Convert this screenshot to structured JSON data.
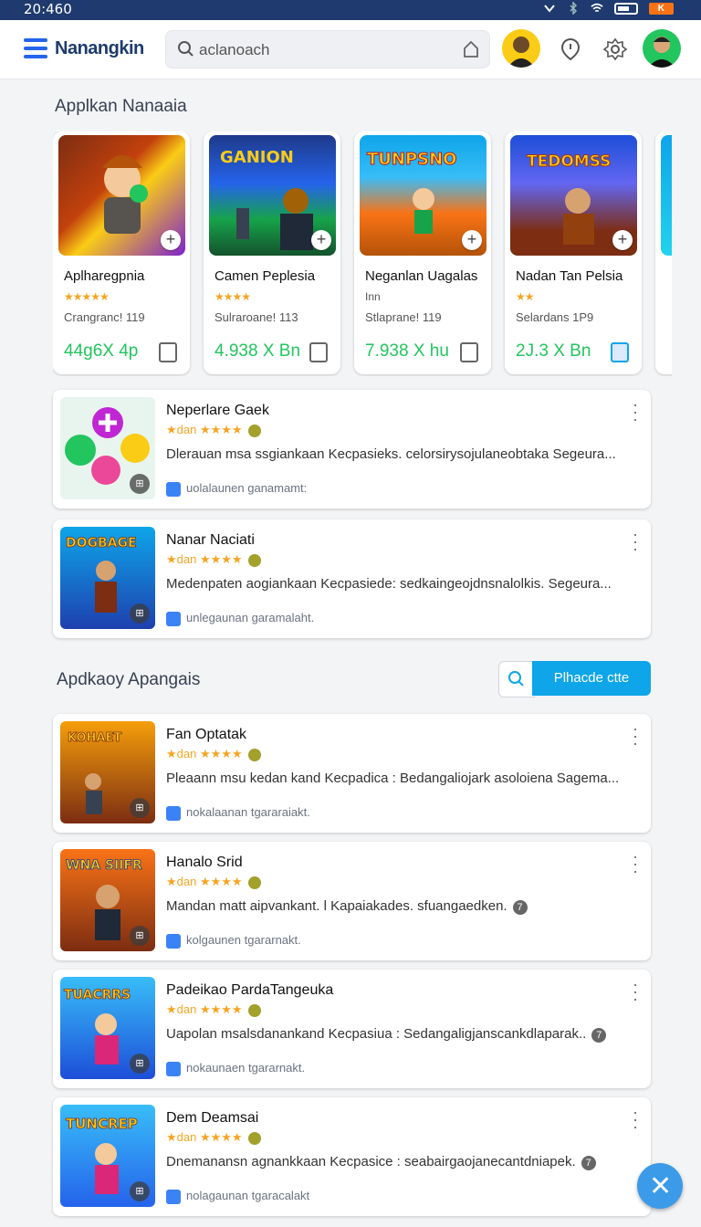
{
  "status": {
    "time": "20:460",
    "badge": "K"
  },
  "appbar": {
    "brand": "Nanangkin",
    "search_placeholder": "aclanoach"
  },
  "sections": {
    "featured_title": "Applkan Nanaaia",
    "list_title": "Apdkaoy Apangais",
    "filter_button": "Plhacde ctte"
  },
  "featured": [
    {
      "name": "Aplharegpnia",
      "stars": "★★★★★",
      "sub": "Crangranc! 119",
      "price": "44g6X 4p"
    },
    {
      "name": "Camen Peplesia",
      "stars": "★★★★",
      "sub": "Sulraroane! 113",
      "price": "4.938 X Bn"
    },
    {
      "name": "Neganlan Uagalas",
      "stars": "Inn",
      "sub": "Stlaprane! 119",
      "price": "7.938 X hu"
    },
    {
      "name": "Nadan Tan Pelsia",
      "stars": "★★",
      "sub": "Selardans 1P9",
      "price": "2J.3 X Bn"
    }
  ],
  "recommended": [
    {
      "title": "Neperlare Gaek",
      "rating": "★dan ★★★★",
      "desc": "Dlerauan msa ssgiankaan Kecpasieks. celorsirysojulaneobtaka Segeura...",
      "tag": "uolalaunen ganamamt:"
    },
    {
      "title": "Nanar Naciati",
      "rating": "★dan ★★★★",
      "desc": "Medenpaten aogiankaan Kecpasiede: sedkaingeojdnsnalolkis. Segeura...",
      "tag": "unlegaunan garamalaht."
    }
  ],
  "list": [
    {
      "title": "Fan Optatak",
      "rating": "★dan ★★★★",
      "desc": "Pleaann msu kedan kand Kecpadica : Bedangaliojark asoloiena Sagema...",
      "tag": "nokalaanan tgararaiakt.",
      "q": ""
    },
    {
      "title": "Hanalo Srid",
      "rating": "★dan ★★★★",
      "desc": "Mandan matt aipvankant. l Kapaiakades. sfuangaedken.",
      "tag": "kolgaunen tgararnakt.",
      "q": "7"
    },
    {
      "title": "Padeikao PardaTangeuka",
      "rating": "★dan ★★★★",
      "desc": "Uapolan msalsdanankand Kecpasiua : Sedangaligjanscankdlaparak..",
      "tag": "nokaunaen tgararnakt.",
      "q": "7"
    },
    {
      "title": "Dem Deamsai",
      "rating": "★dan ★★★★",
      "desc": "Dnemanansn agnankkaan Kecpasice : seabairgaojanecantdniapek.",
      "tag": "nolagaunan tgaracalakt",
      "q": "7"
    }
  ]
}
